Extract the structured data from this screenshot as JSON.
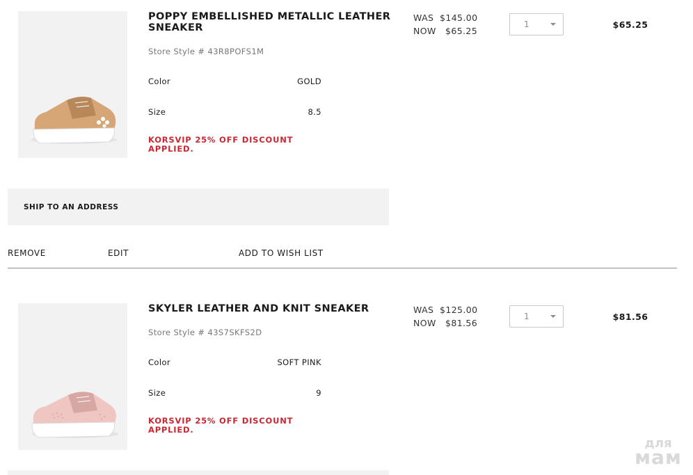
{
  "items": [
    {
      "title": "POPPY EMBELLISHED METALLIC LEATHER SNEAKER",
      "style_no": "Store Style # 43R8POFS1M",
      "color_label": "Color",
      "color_value": "GOLD",
      "size_label": "Size",
      "size_value": "8.5",
      "promo": "KORSVIP 25% OFF DISCOUNT APPLIED.",
      "was_label": "WAS",
      "was_price": "$145.00",
      "now_label": "NOW",
      "now_price": "$65.25",
      "qty": "1",
      "total": "$65.25",
      "image_icon": "gold-sneaker-icon",
      "shoe_color": "#d7a676",
      "shoe_shade": "#b8875a"
    },
    {
      "title": "SKYLER LEATHER AND KNIT SNEAKER",
      "style_no": "Store Style # 43S7SKFS2D",
      "color_label": "Color",
      "color_value": "SOFT PINK",
      "size_label": "Size",
      "size_value": "9",
      "promo": "KORSVIP 25% OFF DISCOUNT APPLIED.",
      "was_label": "WAS",
      "was_price": "$125.00",
      "now_label": "NOW",
      "now_price": "$81.56",
      "qty": "1",
      "total": "$81.56",
      "image_icon": "pink-sneaker-icon",
      "shoe_color": "#efc6c2",
      "shoe_shade": "#d6a7a3"
    }
  ],
  "shipping": {
    "label": "SHIP TO AN ADDRESS"
  },
  "actions": {
    "remove": "REMOVE",
    "edit": "EDIT",
    "wishlist": "ADD TO WISH LIST"
  },
  "watermark": {
    "line1": "для",
    "line2": "мам"
  },
  "colors": {
    "promo": "#cc2631",
    "panel": "#f2f2f2",
    "divider": "#8c8c8c"
  }
}
